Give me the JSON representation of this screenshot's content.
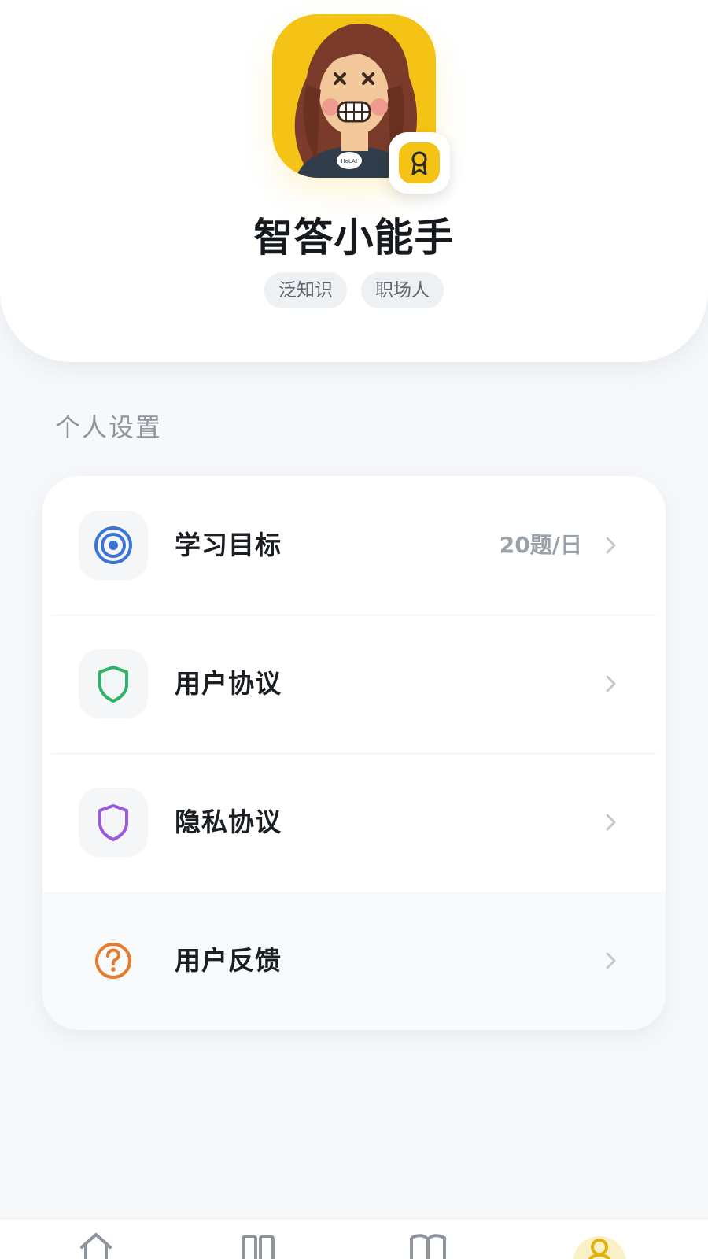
{
  "profile": {
    "name": "智答小能手",
    "avatar_icon": "cartoon-avatar-icon",
    "badge_icon": "award-ribbon-icon",
    "avatar_bubble_text": "HoLA!",
    "tags": [
      "泛知识",
      "职场人"
    ]
  },
  "settings": {
    "section_title": "个人设置",
    "items": [
      {
        "label": "学习目标",
        "value": "20题/日",
        "icon": "target-icon",
        "icon_color": "#3b73d9"
      },
      {
        "label": "用户协议",
        "value": "",
        "icon": "shield-icon",
        "icon_color": "#2fb36b"
      },
      {
        "label": "隐私协议",
        "value": "",
        "icon": "shield-icon",
        "icon_color": "#9b59e0"
      },
      {
        "label": "用户反馈",
        "value": "",
        "icon": "question-circle-icon",
        "icon_color": "#e57b2e"
      }
    ]
  },
  "bottom_nav": {
    "items": [
      {
        "icon": "home-icon",
        "active": false
      },
      {
        "icon": "grid-icon",
        "active": false
      },
      {
        "icon": "book-icon",
        "active": false
      },
      {
        "icon": "user-icon",
        "active": true
      }
    ],
    "accent": "#f5c316"
  },
  "colors": {
    "brand_yellow": "#f5c316",
    "background": "#f6f8fa"
  }
}
